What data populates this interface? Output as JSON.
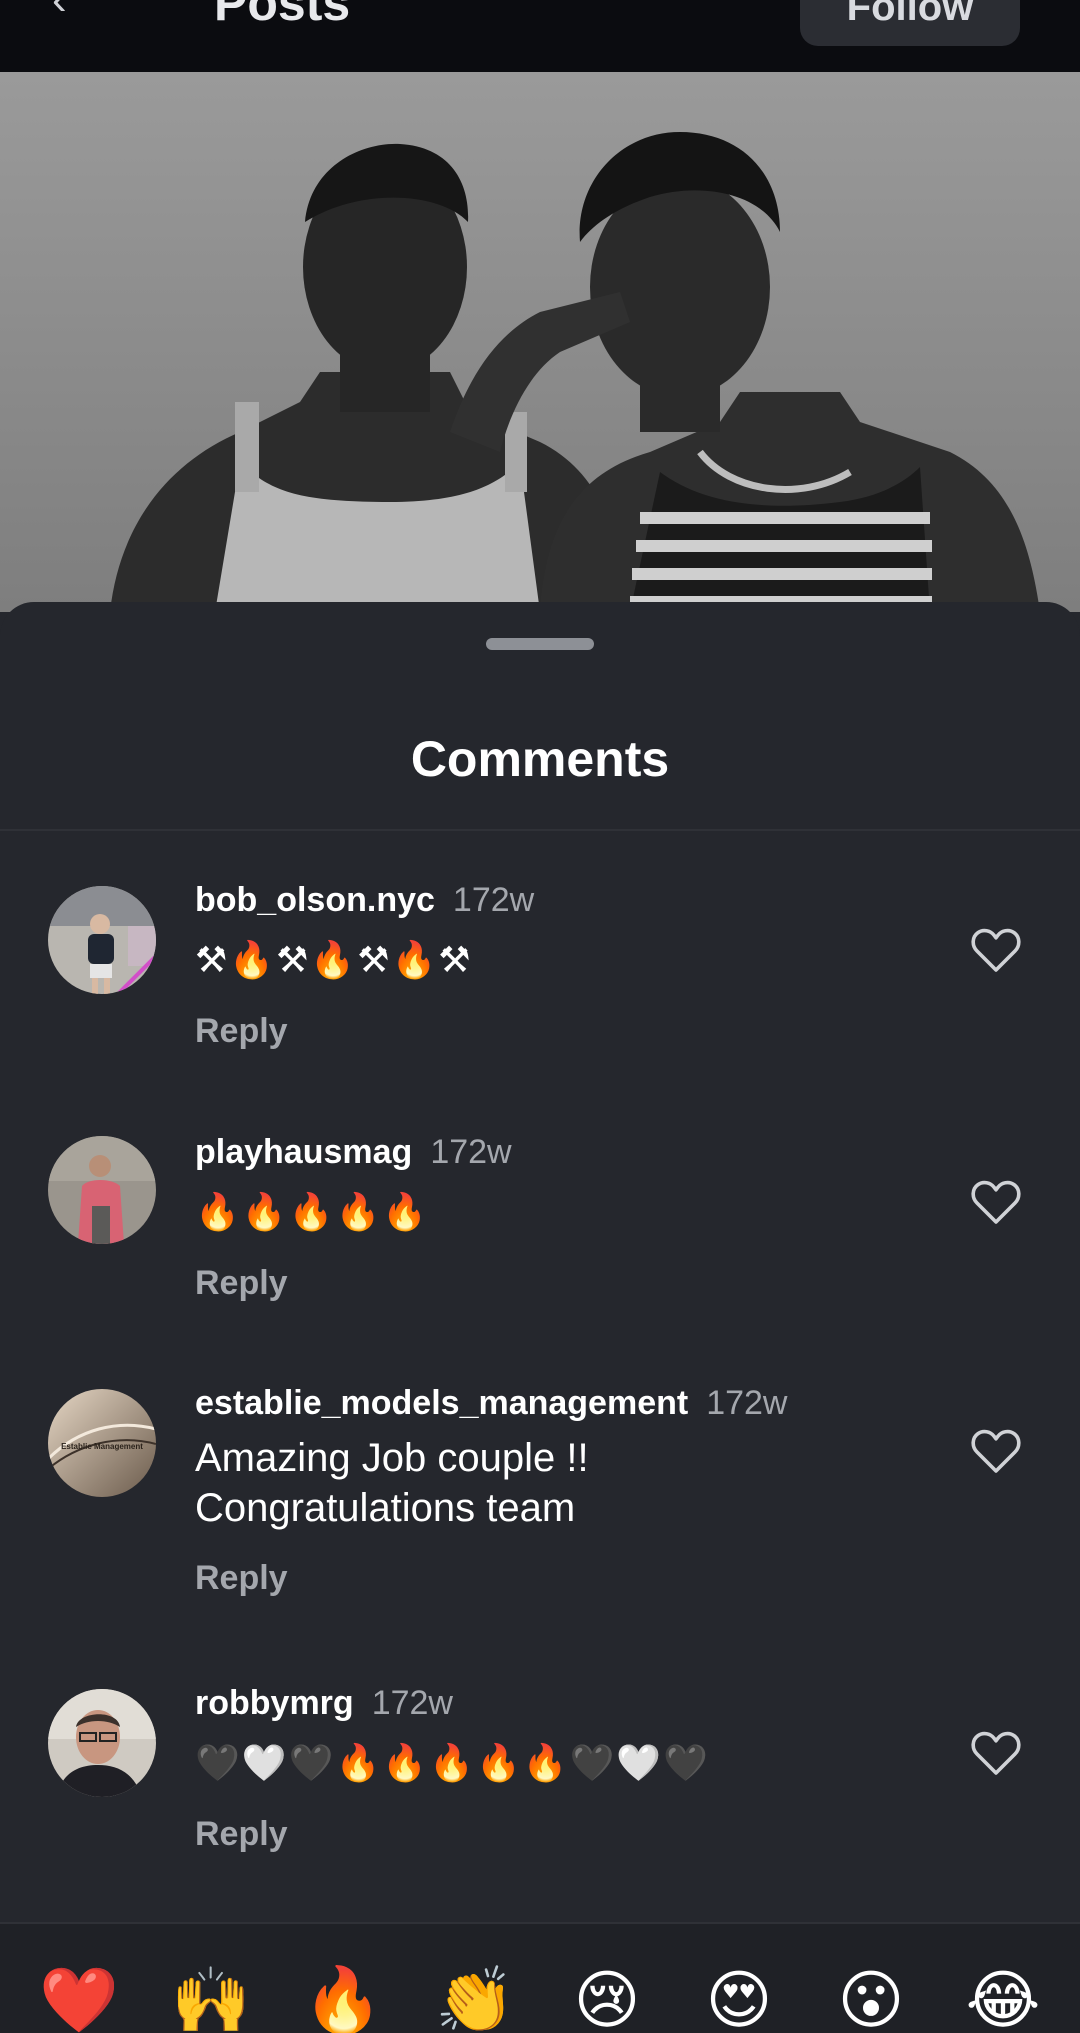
{
  "header": {
    "back_icon": "chevron-left-icon",
    "title": "Posts",
    "follow_label": "Follow"
  },
  "sheet": {
    "title": "Comments"
  },
  "comments": [
    {
      "username": "bob_olson.nyc",
      "time": "172w",
      "text": "⚒🔥⚒🔥⚒🔥⚒",
      "reply": "Reply"
    },
    {
      "username": "playhausmag",
      "time": "172w",
      "text": "🔥🔥🔥🔥🔥",
      "reply": "Reply"
    },
    {
      "username": "establie_models_management",
      "time": "172w",
      "text_line1": "Amazing Job couple !!",
      "text_line2": "Congratulations team",
      "reply": "Reply",
      "avatar_text": "Establie Management"
    },
    {
      "username": "robbymrg",
      "time": "172w",
      "text": "🖤🤍🖤🔥🔥🔥🔥🔥🖤🤍🖤",
      "reply": "Reply"
    }
  ],
  "reactions": [
    "❤️",
    "🙌",
    "🔥",
    "👏",
    "😢",
    "😍",
    "😮",
    "😂"
  ],
  "colors": {
    "sheet_bg": "#25272d",
    "topbar_bg": "#0b0c10",
    "muted_text": "#a4a7ad",
    "heart_outline": "#d0d2d6"
  }
}
